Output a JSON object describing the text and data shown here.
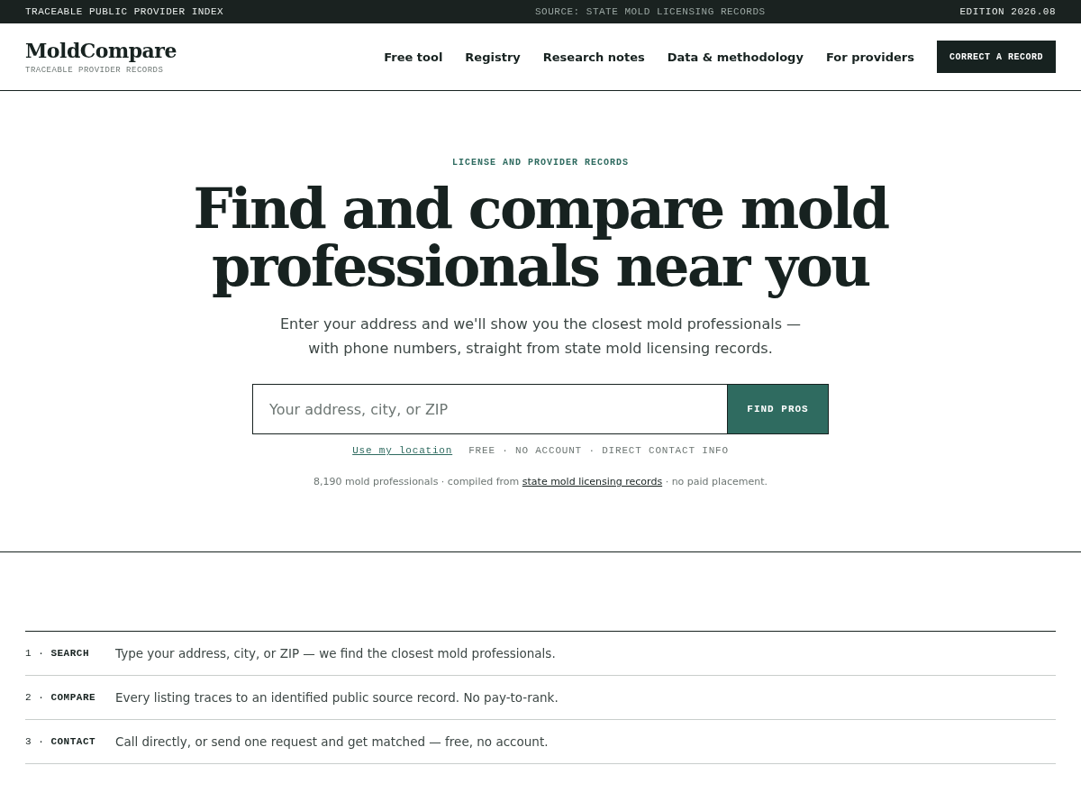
{
  "top_bar": {
    "left": "TRACEABLE PUBLIC PROVIDER INDEX",
    "center": "SOURCE: STATE MOLD LICENSING RECORDS",
    "right": "EDITION 2026.08"
  },
  "header": {
    "logo": "MoldCompare",
    "tagline": "TRACEABLE PROVIDER RECORDS",
    "nav": [
      "Free tool",
      "Registry",
      "Research notes",
      "Data & methodology",
      "For providers"
    ],
    "cta": "CORRECT A RECORD"
  },
  "hero": {
    "eyebrow": "LICENSE AND PROVIDER RECORDS",
    "title": "Find and compare mold professionals near you",
    "subtitle": "Enter your address and we'll show you the closest mold professionals — with phone numbers, straight from state mold licensing records.",
    "search": {
      "placeholder": "Your address, city, or ZIP",
      "button": "FIND PROS"
    },
    "location_link": "Use my location",
    "perks": "FREE · NO ACCOUNT · DIRECT CONTACT INFO",
    "note_before": "8,190 mold professionals · compiled from",
    "note_link": "state mold licensing records",
    "note_after": "· no paid placement."
  },
  "steps": [
    {
      "label": "1 · **SEARCH**",
      "text": "Type your address, city, or ZIP — we find the closest mold professionals."
    },
    {
      "label": "2 · **COMPARE**",
      "text": "Every listing traces to an identified public source record. No pay-to-rank."
    },
    {
      "label": "3 · **CONTACT**",
      "text": "Call directly, or send one request and get matched — free, no account."
    }
  ]
}
